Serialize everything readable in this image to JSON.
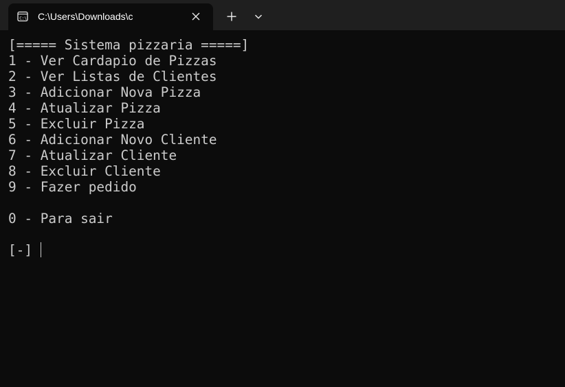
{
  "window": {
    "tab_title": "C:\\Users\\Downloads\\c",
    "tab_icon": "console-icon",
    "close_icon": "close-icon",
    "new_tab_icon": "plus-icon",
    "dropdown_icon": "chevron-down-icon"
  },
  "console": {
    "header": "[===== Sistema pizzaria =====]",
    "menu": [
      "1 - Ver Cardapio de Pizzas",
      "2 - Ver Listas de Clientes",
      "3 - Adicionar Nova Pizza",
      "4 - Atualizar Pizza",
      "5 - Excluir Pizza",
      "6 - Adicionar Novo Cliente",
      "7 - Atualizar Cliente",
      "8 - Excluir Cliente",
      "9 - Fazer pedido"
    ],
    "exit_option": "0 - Para sair",
    "prompt": "[-]"
  }
}
